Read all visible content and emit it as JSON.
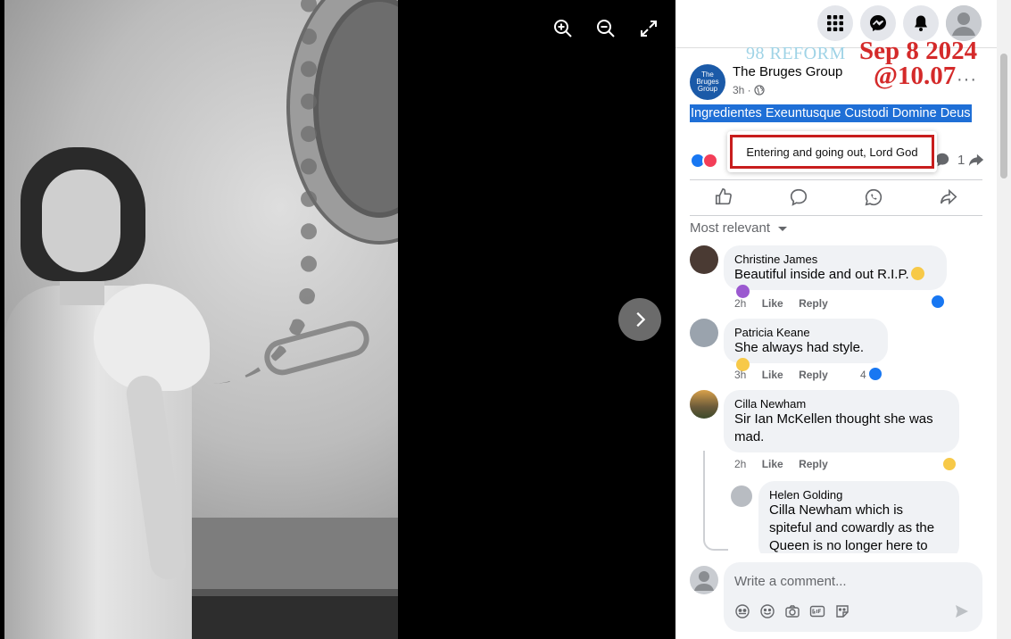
{
  "viewer": {
    "zoom_in_label": "Zoom in",
    "zoom_out_label": "Zoom out",
    "fullscreen_label": "Full screen",
    "next_label": "Next"
  },
  "overlay": {
    "reform": "98 REFORM",
    "date": "Sep 8 2024",
    "time": "@10.07"
  },
  "post": {
    "page_name": "The Bruges Group",
    "avatar_text": "The Bruges Group",
    "meta": "3h ·",
    "text": "Ingredientes Exeuntusque Custodi Domine Deus",
    "more": "···",
    "reaction_count": "1",
    "tooltip": "Entering and going out, Lord God"
  },
  "sort": {
    "label": "Most relevant"
  },
  "comments": [
    {
      "name": "Christine James",
      "text": "Beautiful inside and out R.I.P.",
      "time": "2h",
      "like": "Like",
      "reply": "Reply",
      "reactions": ""
    },
    {
      "name": "Patricia Keane",
      "text": "She always had style.",
      "time": "3h",
      "like": "Like",
      "reply": "Reply",
      "reactions": "4"
    },
    {
      "name": "Cilla Newham",
      "text_line1": "Sir Ian McKellen thought she was",
      "text_line2": "mad.",
      "time": "2h",
      "like": "Like",
      "reply": "Reply",
      "reactions": ""
    },
    {
      "name": "Helen Golding",
      "mention": "Cilla Newham",
      "text_line1": " which is",
      "text_line2": "spiteful and cowardly as the",
      "text_line3": "Queen is no longer here to"
    }
  ],
  "composer": {
    "placeholder": "Write a comment..."
  },
  "colors": {
    "accent": "#1877f2",
    "stamp_red": "#d42a2a",
    "stamp_blue": "#9fd3e6",
    "highlight": "#1f6fd6"
  }
}
